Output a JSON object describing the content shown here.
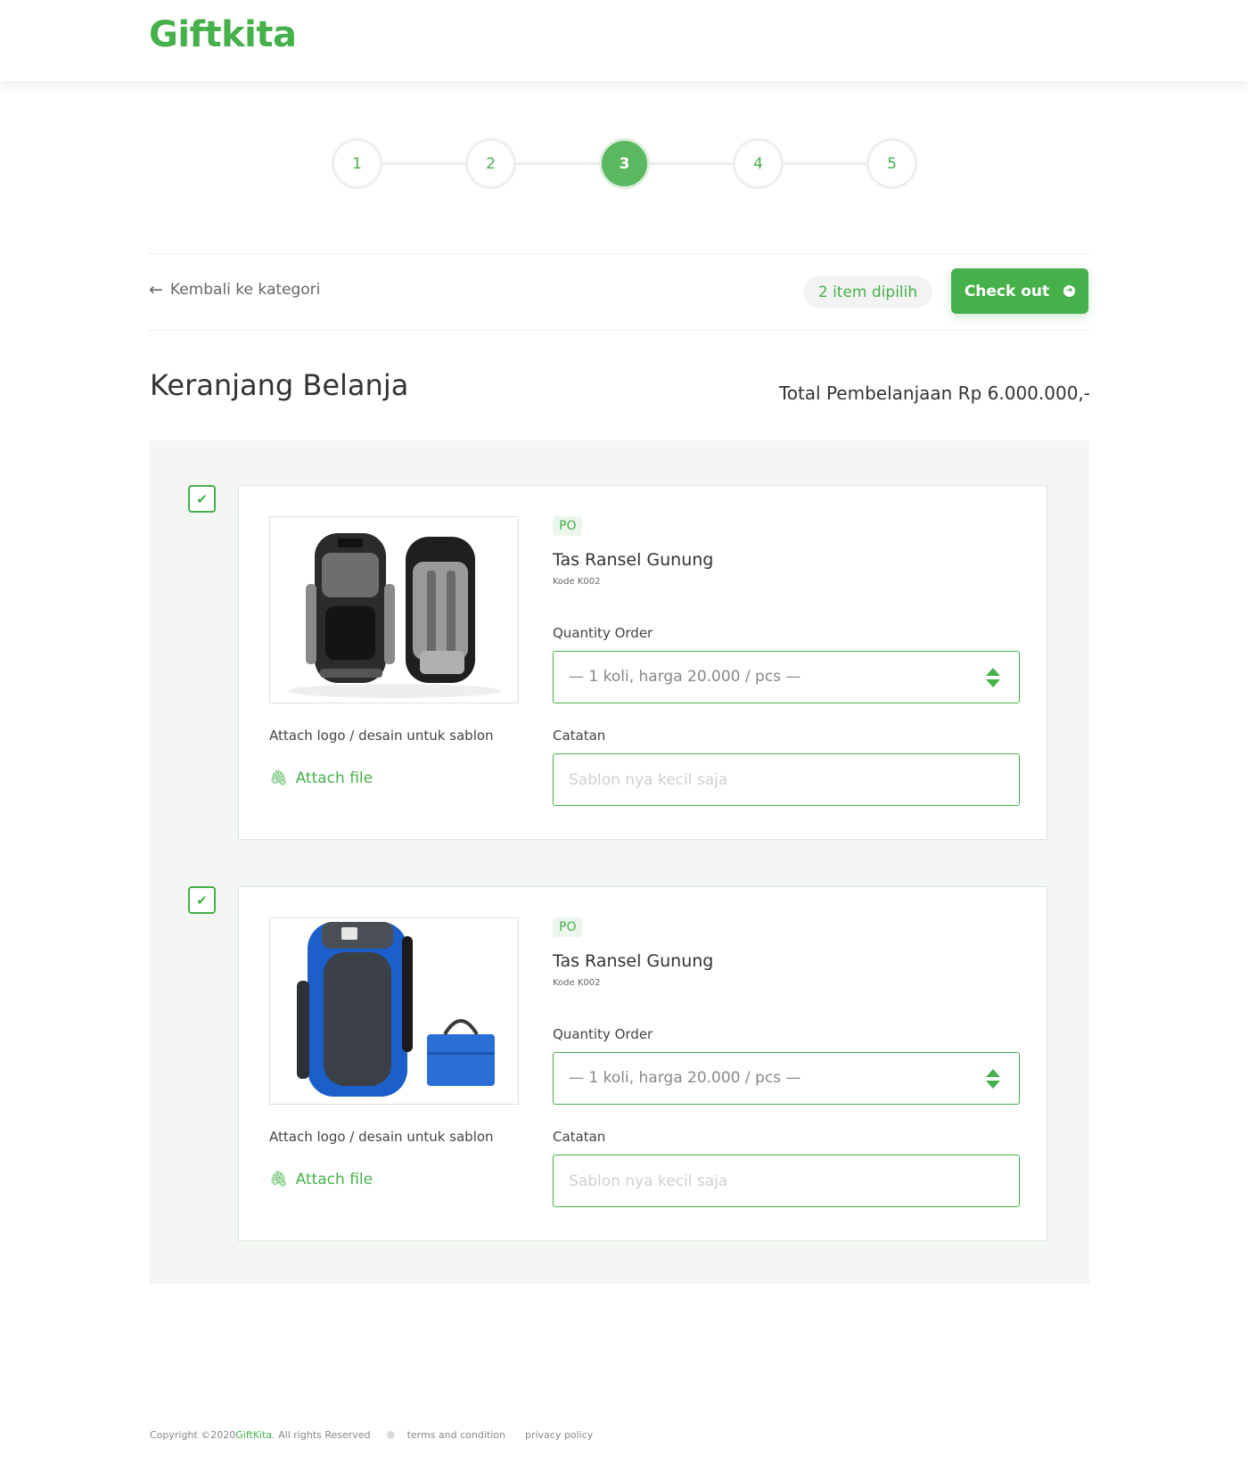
{
  "header": {
    "logo": "Giftkita"
  },
  "stepper": {
    "steps": [
      "1",
      "2",
      "3",
      "4",
      "5"
    ],
    "active_step": 3
  },
  "toolbar": {
    "back_label": "Kembali ke kategori",
    "items_badge": "2 item dipilih",
    "checkout_label": "Check out"
  },
  "page": {
    "title": "Keranjang Belanja",
    "total": "Total Pembelanjaan Rp 6.000.000,-"
  },
  "cart": {
    "items": [
      {
        "checked": true,
        "badge": "PO",
        "name": "Tas Ransel Gunung",
        "code": "Kode K002",
        "qty_label": "Quantity Order",
        "qty_value": "— 1 koli, harga 20.000 / pcs —",
        "note_label": "Catatan",
        "note_placeholder": "Sablon nya kecil saja",
        "attach_label": "Attach logo / desain untuk sablon",
        "attach_link": "Attach file"
      },
      {
        "checked": true,
        "badge": "PO",
        "name": "Tas Ransel Gunung",
        "code": "Kode K002",
        "qty_label": "Quantity Order",
        "qty_value": "— 1 koli, harga 20.000 / pcs —",
        "note_label": "Catatan",
        "note_placeholder": "Sablon nya kecil saja",
        "attach_label": "Attach logo / desain untuk sablon",
        "attach_link": "Attach file"
      }
    ]
  },
  "footer": {
    "copyright_prefix": "Copyright ©2020 ",
    "brand": "GiftKita",
    "copyright_suffix": ". All rights Reserved",
    "links": [
      "terms and condition",
      "privacy policy"
    ]
  },
  "colors": {
    "accent": "#46b04a",
    "panel_bg": "#f4f6f3"
  },
  "icons": [
    "arrow-left-icon",
    "arrow-right-circle-icon",
    "check-icon",
    "sort-icon",
    "paperclip-icon"
  ]
}
